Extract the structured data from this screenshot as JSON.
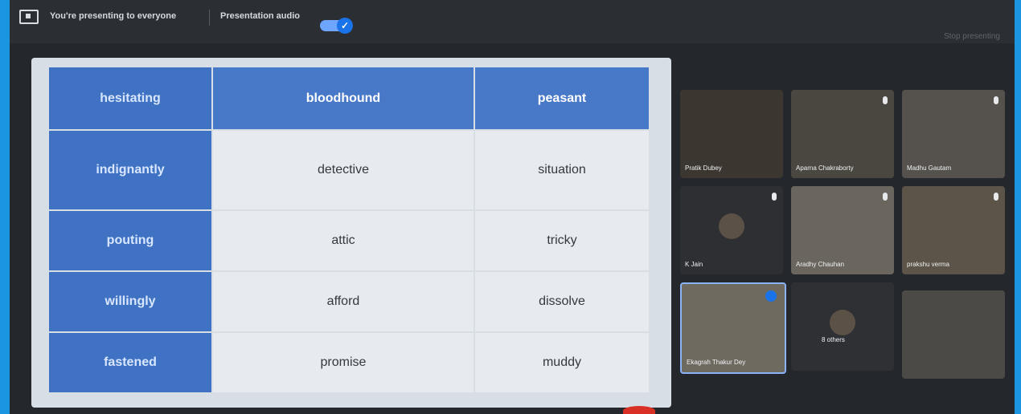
{
  "topbar": {
    "presenting_text": "You're presenting to everyone",
    "audio_label": "Presentation audio",
    "audio_on": true,
    "stop_label": "Stop presenting"
  },
  "slide": {
    "headers": [
      "hesitating",
      "bloodhound",
      "peasant"
    ],
    "rows": [
      [
        "indignantly",
        "detective",
        "situation"
      ],
      [
        "pouting",
        "attic",
        "tricky"
      ],
      [
        "willingly",
        "afford",
        "dissolve"
      ],
      [
        "fastened",
        "promise",
        "muddy"
      ]
    ]
  },
  "participants": [
    {
      "name": "Pratik Dubey"
    },
    {
      "name": "Aparna Chakraborty"
    },
    {
      "name": "Madhu Gautam"
    },
    {
      "name": "K Jain"
    },
    {
      "name": "Aradhy Chauhan"
    },
    {
      "name": "prakshu verma"
    },
    {
      "name": "Ekagrah Thakur Dey"
    },
    {
      "name": "8 others"
    },
    {
      "name": ""
    }
  ]
}
